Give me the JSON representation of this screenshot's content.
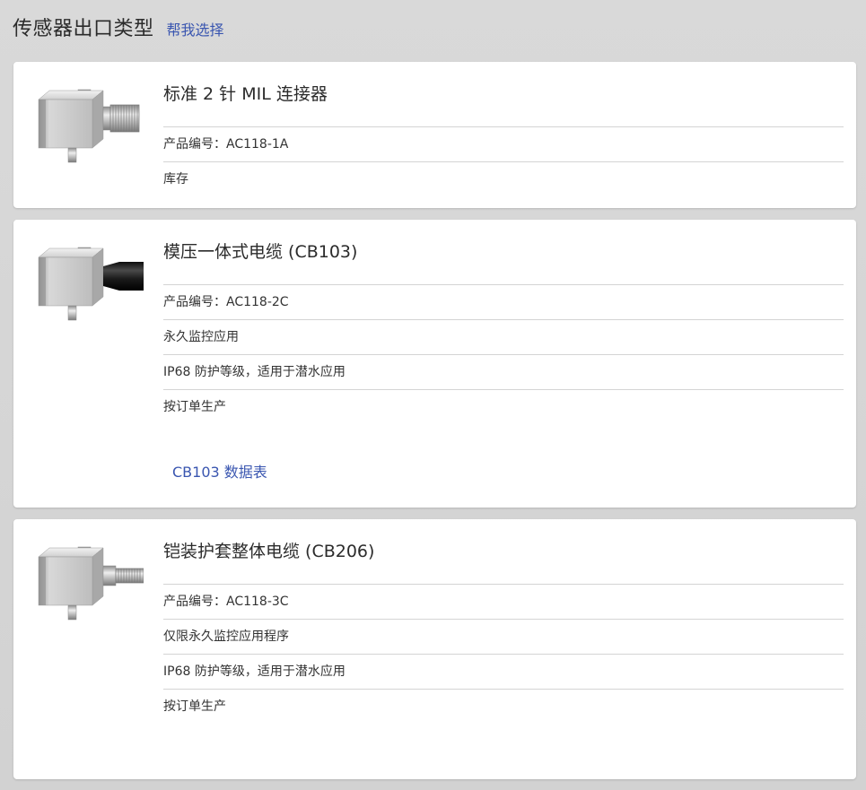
{
  "header": {
    "title": "传感器出口类型",
    "help_link": "帮我选择"
  },
  "cards": [
    {
      "title": "标准 2 针 MIL 连接器",
      "image_icon": "mil-connector-sensor-image",
      "attributes": [
        "产品编号：AC118-1A",
        "库存"
      ]
    },
    {
      "title": "模压一体式电缆 (CB103)",
      "image_icon": "molded-cable-sensor-image",
      "attributes": [
        "产品编号：AC118-2C",
        "永久监控应用",
        "IP68 防护等级，适用于潜水应用",
        "按订单生产"
      ],
      "link": "CB103 数据表"
    },
    {
      "title": "铠装护套整体电缆 (CB206)",
      "image_icon": "armored-cable-sensor-image",
      "attributes": [
        "产品编号：AC118-3C",
        "仅限永久监控应用程序",
        "IP68 防护等级，适用于潜水应用",
        "按订单生产"
      ]
    }
  ],
  "colors": {
    "background": "#d6d6d6",
    "card": "#ffffff",
    "link": "#3a56b0",
    "divider": "#d4d4d4"
  }
}
